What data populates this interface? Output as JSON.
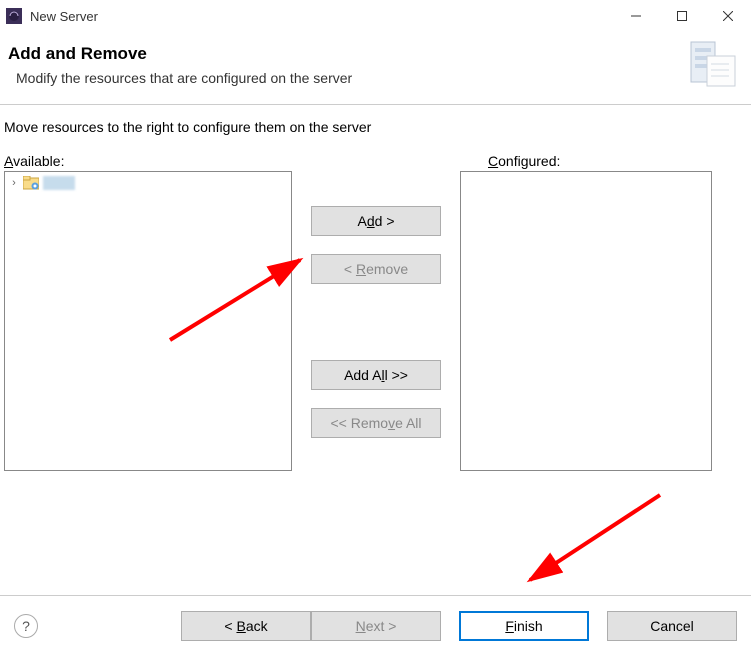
{
  "window": {
    "title": "New Server"
  },
  "header": {
    "title": "Add and Remove",
    "subtitle": "Modify the resources that are configured on the server"
  },
  "content": {
    "instruction": "Move resources to the right to configure them on the server",
    "available_label": "Available:",
    "configured_label": "Configured:",
    "available_items": [
      {
        "name": ""
      }
    ]
  },
  "buttons": {
    "add": "Add >",
    "remove": "< Remove",
    "add_all": "Add All >>",
    "remove_all": "<< Remove All"
  },
  "footer": {
    "back": "< Back",
    "next": "Next >",
    "finish": "Finish",
    "cancel": "Cancel"
  },
  "accesskeys": {
    "available": "A",
    "configured": "C",
    "add": "d",
    "remove": "R",
    "add_all": "l",
    "remove_all": "v",
    "back": "B",
    "next": "N",
    "finish": "F"
  }
}
